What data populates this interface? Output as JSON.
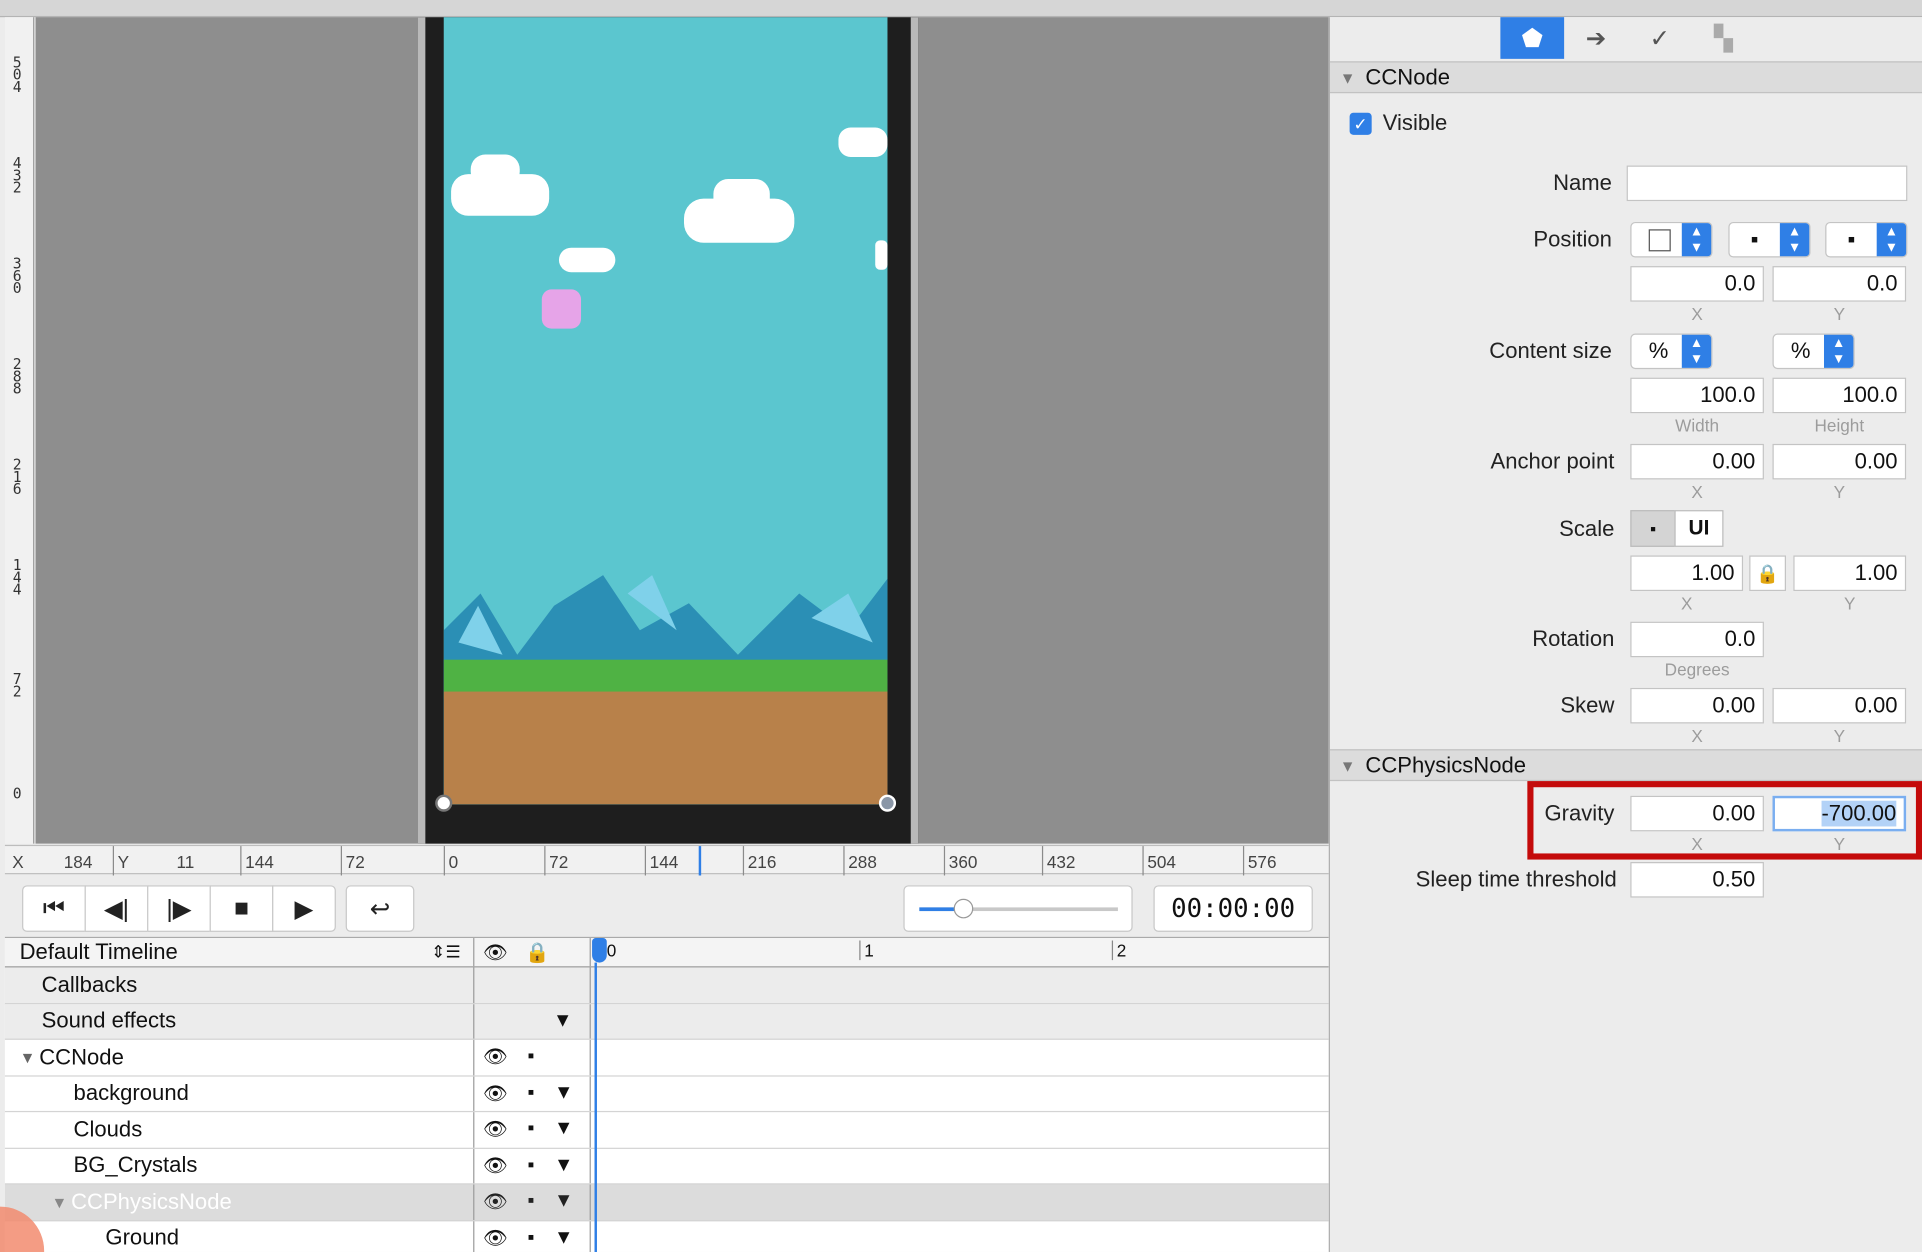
{
  "ruler": {
    "vertical_labels": [
      "5\n0\n4",
      "4\n3\n2",
      "3\n6\n0",
      "2\n8\n8",
      "2\n1\n6",
      "1\n4\n4",
      "7\n2",
      "0"
    ],
    "coord_x_label": "X",
    "coord_x_value": "184",
    "coord_y_label": "Y",
    "coord_y_value": "11",
    "horizontal_ticks": [
      "144",
      "72",
      "0",
      "72",
      "144",
      "216",
      "288",
      "360",
      "432",
      "504",
      "576"
    ]
  },
  "transport": {
    "first_icon": "skip-to-start-icon",
    "prev_icon": "step-back-icon",
    "next_icon": "step-forward-icon",
    "stop_icon": "stop-icon",
    "play_icon": "play-icon",
    "loop_icon": "loop-icon",
    "timecode": "00:00:00"
  },
  "timeline": {
    "selector_label": "Default Timeline",
    "time_marks": [
      "0",
      "1",
      "2"
    ],
    "rows": [
      {
        "name": "Callbacks"
      },
      {
        "name": "Sound effects"
      },
      {
        "name": "CCNode"
      },
      {
        "name": "background"
      },
      {
        "name": "Clouds"
      },
      {
        "name": "BG_Crystals"
      },
      {
        "name": "CCPhysicsNode"
      },
      {
        "name": "Ground"
      }
    ]
  },
  "inspector": {
    "tabs": [
      "properties-icon",
      "code-connection-icon",
      "physics-icon",
      "templates-icon"
    ],
    "ccnode_header": "CCNode",
    "visible_label": "Visible",
    "visible_checked": true,
    "name_label": "Name",
    "name_value": "",
    "position_label": "Position",
    "position_x": "0.0",
    "position_y": "0.0",
    "x_caption": "X",
    "y_caption": "Y",
    "content_size_label": "Content size",
    "content_unit_w": "%",
    "content_unit_h": "%",
    "content_w": "100.0",
    "content_h": "100.0",
    "width_caption": "Width",
    "height_caption": "Height",
    "anchor_label": "Anchor point",
    "anchor_x": "0.00",
    "anchor_y": "0.00",
    "scale_label": "Scale",
    "scale_mode_point": "▪",
    "scale_mode_ui": "UI",
    "scale_x": "1.00",
    "scale_y": "1.00",
    "rotation_label": "Rotation",
    "rotation_value": "0.0",
    "degrees_caption": "Degrees",
    "skew_label": "Skew",
    "skew_x": "0.00",
    "skew_y": "0.00",
    "physics_header": "CCPhysicsNode",
    "gravity_label": "Gravity",
    "gravity_x": "0.00",
    "gravity_y": "-700.00",
    "sleep_label": "Sleep time threshold",
    "sleep_value": "0.50"
  },
  "colors": {
    "accent": "#2f7fe6",
    "highlight": "#c40b0b",
    "sky": "#5bc6cf"
  }
}
